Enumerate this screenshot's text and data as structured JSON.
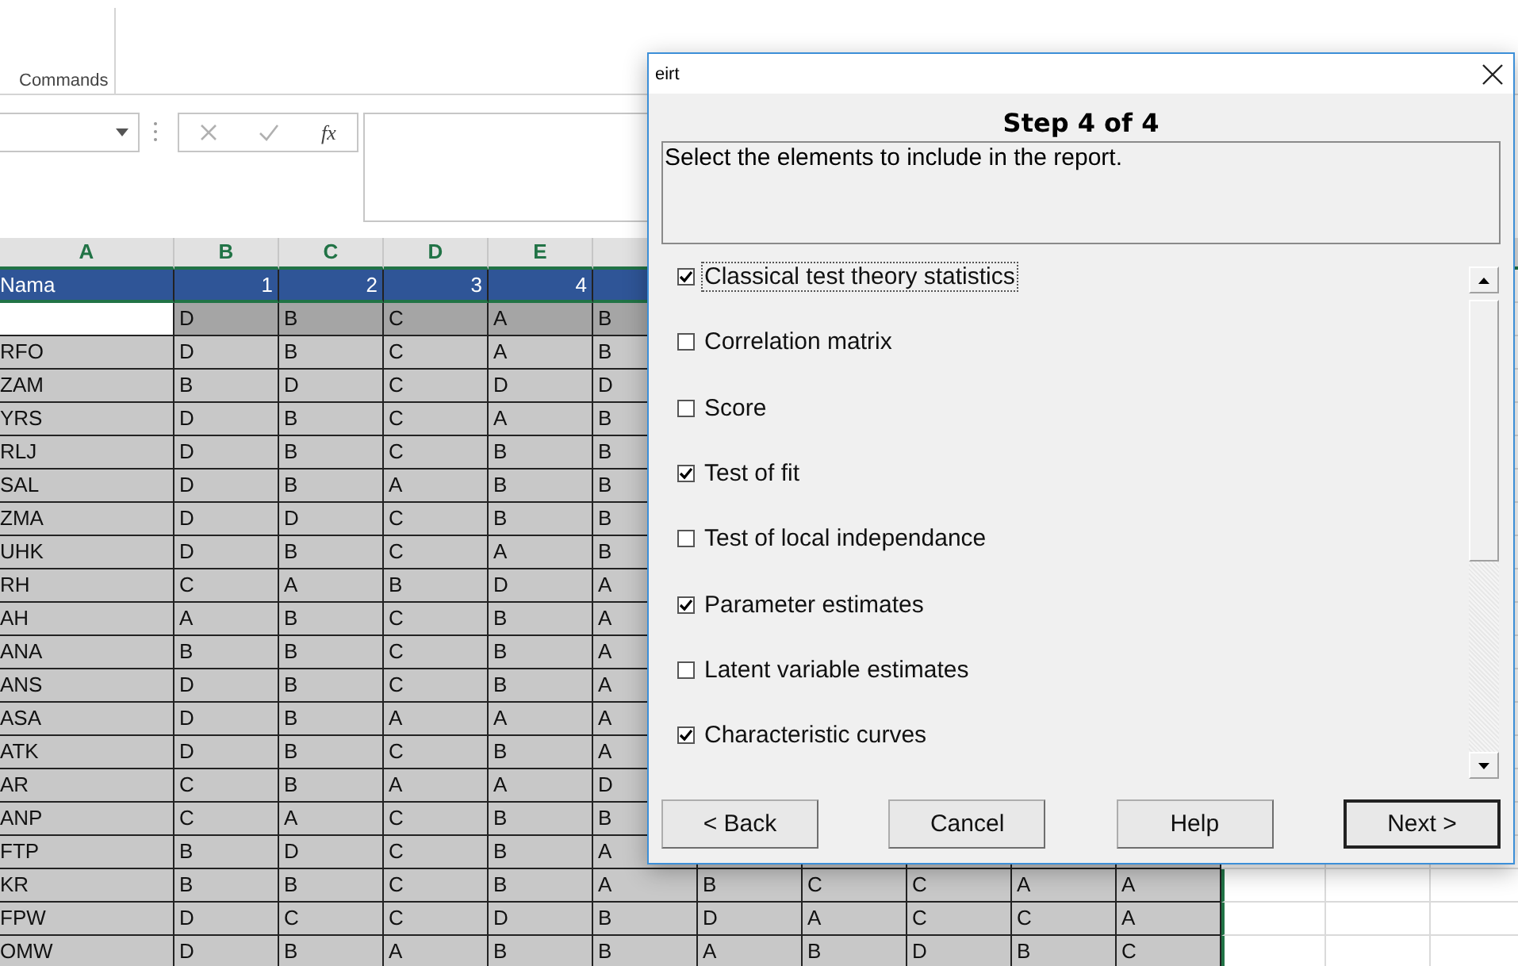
{
  "ribbon": {
    "group_label": "Commands"
  },
  "formula_bar": {
    "function_label": "fx"
  },
  "sheet": {
    "columns": [
      "A",
      "B",
      "C",
      "D",
      "E"
    ],
    "rows": [
      {
        "kind": "title",
        "cells": [
          "Nama",
          "1",
          "2",
          "3",
          "4"
        ]
      },
      {
        "kind": "key",
        "cells": [
          "",
          "D",
          "B",
          "C",
          "A",
          "B"
        ]
      },
      {
        "kind": "data",
        "cells": [
          "RFO",
          "D",
          "B",
          "C",
          "A",
          "B"
        ]
      },
      {
        "kind": "data",
        "cells": [
          "ZAM",
          "B",
          "D",
          "C",
          "D",
          "D"
        ]
      },
      {
        "kind": "data",
        "cells": [
          "YRS",
          "D",
          "B",
          "C",
          "A",
          "B"
        ]
      },
      {
        "kind": "data",
        "cells": [
          "RLJ",
          "D",
          "B",
          "C",
          "B",
          "B"
        ]
      },
      {
        "kind": "data",
        "cells": [
          "SAL",
          "D",
          "B",
          "A",
          "B",
          "B"
        ]
      },
      {
        "kind": "data",
        "cells": [
          "ZMA",
          "D",
          "D",
          "C",
          "B",
          "B"
        ]
      },
      {
        "kind": "data",
        "cells": [
          "UHK",
          "D",
          "B",
          "C",
          "A",
          "B"
        ]
      },
      {
        "kind": "data",
        "cells": [
          "RH",
          "C",
          "A",
          "B",
          "D",
          "A"
        ]
      },
      {
        "kind": "data",
        "cells": [
          "AH",
          "A",
          "B",
          "C",
          "B",
          "A"
        ]
      },
      {
        "kind": "data",
        "cells": [
          "ANA",
          "B",
          "B",
          "C",
          "B",
          "A"
        ]
      },
      {
        "kind": "data",
        "cells": [
          "ANS",
          "D",
          "B",
          "C",
          "B",
          "A"
        ]
      },
      {
        "kind": "data",
        "cells": [
          "ASA",
          "D",
          "B",
          "A",
          "A",
          "A"
        ]
      },
      {
        "kind": "data",
        "cells": [
          "ATK",
          "D",
          "B",
          "C",
          "B",
          "A"
        ]
      },
      {
        "kind": "data",
        "cells": [
          "AR",
          "C",
          "B",
          "A",
          "A",
          "D"
        ]
      },
      {
        "kind": "data",
        "cells": [
          "ANP",
          "C",
          "A",
          "C",
          "B",
          "B"
        ]
      },
      {
        "kind": "data",
        "cells": [
          "FTP",
          "B",
          "D",
          "C",
          "B",
          "A"
        ]
      },
      {
        "kind": "data",
        "cells": [
          "KR",
          "B",
          "B",
          "C",
          "B",
          "A",
          "B",
          "C",
          "C",
          "A",
          "A"
        ]
      },
      {
        "kind": "data",
        "cells": [
          "FPW",
          "D",
          "C",
          "C",
          "D",
          "B",
          "D",
          "A",
          "C",
          "C",
          "A"
        ]
      },
      {
        "kind": "data",
        "cells": [
          "OMW",
          "D",
          "B",
          "A",
          "B",
          "B",
          "A",
          "B",
          "D",
          "B",
          "C"
        ]
      }
    ]
  },
  "dialog": {
    "title": "eirt",
    "heading": "Step 4 of 4",
    "description": "Select the elements to include in the report.",
    "options": [
      {
        "label": "Classical test theory statistics",
        "checked": true,
        "focused": true
      },
      {
        "label": "Correlation matrix",
        "checked": false,
        "focused": false
      },
      {
        "label": "Score",
        "checked": false,
        "focused": false
      },
      {
        "label": "Test of fit",
        "checked": true,
        "focused": false
      },
      {
        "label": "Test of local independance",
        "checked": false,
        "focused": false
      },
      {
        "label": "Parameter estimates",
        "checked": true,
        "focused": false
      },
      {
        "label": "Latent variable estimates",
        "checked": false,
        "focused": false
      },
      {
        "label": "Characteristic curves",
        "checked": true,
        "focused": false
      }
    ],
    "buttons": [
      {
        "label": "< Back",
        "default": false
      },
      {
        "label": "Cancel",
        "default": false
      },
      {
        "label": "Help",
        "default": false
      },
      {
        "label": "Next >",
        "default": true
      }
    ]
  }
}
